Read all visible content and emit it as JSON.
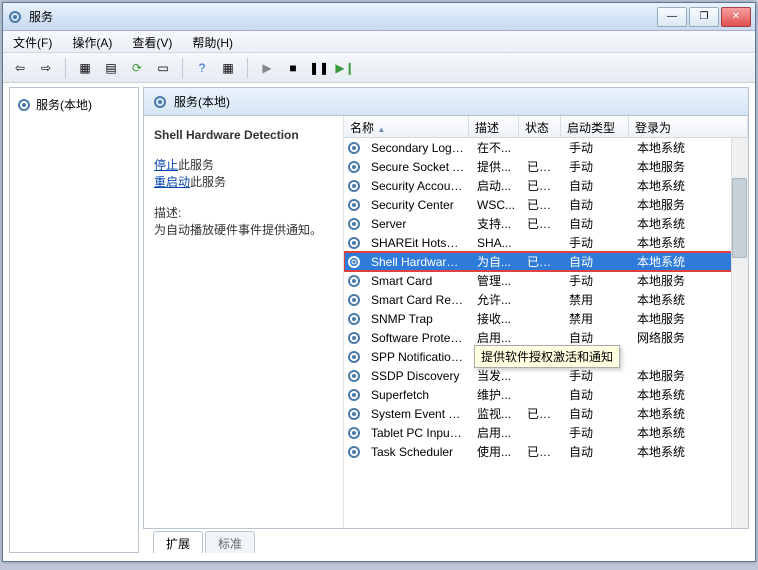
{
  "titlebar": {
    "title": "服务"
  },
  "menubar": {
    "file": "文件(F)",
    "action": "操作(A)",
    "view": "查看(V)",
    "help": "帮助(H)"
  },
  "leftpane": {
    "node": "服务(本地)"
  },
  "rightheader": {
    "label": "服务(本地)"
  },
  "detail": {
    "name": "Shell Hardware Detection",
    "stop": "停止",
    "stop_suffix": "此服务",
    "restart": "重启动",
    "restart_suffix": "此服务",
    "desc_label": "描述:",
    "desc_text": "为自动播放硬件事件提供通知。"
  },
  "columns": {
    "name": "名称",
    "desc": "描述",
    "status": "状态",
    "start": "启动类型",
    "login": "登录为"
  },
  "sort_arrow": "▲",
  "tooltip": "提供软件授权激活和通知",
  "tabs": {
    "ext": "扩展",
    "std": "标准"
  },
  "rows": [
    {
      "name": "Secondary Logon",
      "desc": "在不...",
      "status": "",
      "start": "手动",
      "login": "本地系统",
      "sel": false
    },
    {
      "name": "Secure Socket T...",
      "desc": "提供...",
      "status": "已启动",
      "start": "手动",
      "login": "本地服务",
      "sel": false
    },
    {
      "name": "Security Account...",
      "desc": "启动...",
      "status": "已启动",
      "start": "自动",
      "login": "本地系统",
      "sel": false
    },
    {
      "name": "Security Center",
      "desc": "WSC...",
      "status": "已启动",
      "start": "自动",
      "login": "本地服务",
      "sel": false
    },
    {
      "name": "Server",
      "desc": "支持...",
      "status": "已启动",
      "start": "自动",
      "login": "本地系统",
      "sel": false
    },
    {
      "name": "SHAREit Hotspot...",
      "desc": "SHA...",
      "status": "",
      "start": "手动",
      "login": "本地系统",
      "sel": false
    },
    {
      "name": "Shell Hardware ...",
      "desc": "为自...",
      "status": "已启动",
      "start": "自动",
      "login": "本地系统",
      "sel": true
    },
    {
      "name": "Smart Card",
      "desc": "管理...",
      "status": "",
      "start": "手动",
      "login": "本地服务",
      "sel": false
    },
    {
      "name": "Smart Card Rem...",
      "desc": "允许...",
      "status": "",
      "start": "禁用",
      "login": "本地系统",
      "sel": false
    },
    {
      "name": "SNMP Trap",
      "desc": "接收...",
      "status": "",
      "start": "禁用",
      "login": "本地服务",
      "sel": false
    },
    {
      "name": "Software Protect...",
      "desc": "启用...",
      "status": "",
      "start": "自动",
      "login": "网络服务",
      "sel": false
    },
    {
      "name": "SPP Notification ...",
      "desc": "",
      "status": "",
      "start": "",
      "login": "",
      "sel": false,
      "tooltip": true
    },
    {
      "name": "SSDP Discovery",
      "desc": "当发...",
      "status": "",
      "start": "手动",
      "login": "本地服务",
      "sel": false
    },
    {
      "name": "Superfetch",
      "desc": "维护...",
      "status": "",
      "start": "自动",
      "login": "本地系统",
      "sel": false
    },
    {
      "name": "System Event N...",
      "desc": "监视...",
      "status": "已启动",
      "start": "自动",
      "login": "本地系统",
      "sel": false
    },
    {
      "name": "Tablet PC Input ...",
      "desc": "启用...",
      "status": "",
      "start": "手动",
      "login": "本地系统",
      "sel": false
    },
    {
      "name": "Task Scheduler",
      "desc": "使用...",
      "status": "已启动",
      "start": "自动",
      "login": "本地系统",
      "sel": false
    }
  ]
}
